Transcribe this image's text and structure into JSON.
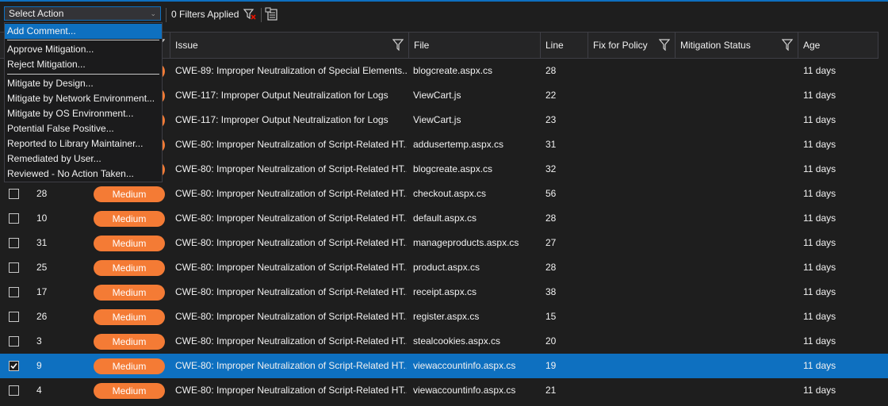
{
  "toolbar": {
    "select_action": "Select Action",
    "filters_applied": "0 Filters Applied",
    "clear_filter_icon": "filter-clear-icon",
    "export_icon": "export-icon"
  },
  "action_menu": {
    "items": [
      "Add Comment...",
      "Approve Mitigation...",
      "Reject Mitigation...",
      "Mitigate by Design...",
      "Mitigate by Network Environment...",
      "Mitigate by OS Environment...",
      "Potential False Positive...",
      "Reported to Library Maintainer...",
      "Remediated by User...",
      "Reviewed - No Action Taken..."
    ],
    "highlighted_index": 0
  },
  "columns": {
    "issue": "Issue",
    "file": "File",
    "line": "Line",
    "fix_for_policy": "Fix for Policy",
    "mitigation_status": "Mitigation Status",
    "age": "Age"
  },
  "colors": {
    "accent": "#0e70c0",
    "medium": "#f47b35",
    "high": "#e51400"
  },
  "rows": [
    {
      "id": "",
      "severity": "",
      "issue": "CWE-89: Improper Neutralization of Special Elements...",
      "file": "blogcreate.aspx.cs",
      "line": "28",
      "age": "11 days",
      "checked": false
    },
    {
      "id": "",
      "severity": "",
      "issue": "CWE-117: Improper Output Neutralization for Logs",
      "file": "ViewCart.js",
      "line": "22",
      "age": "11 days",
      "checked": false
    },
    {
      "id": "",
      "severity": "",
      "issue": "CWE-117: Improper Output Neutralization for Logs",
      "file": "ViewCart.js",
      "line": "23",
      "age": "11 days",
      "checked": false
    },
    {
      "id": "",
      "severity": "",
      "issue": "CWE-80: Improper Neutralization of Script-Related HT...",
      "file": "addusertemp.aspx.cs",
      "line": "31",
      "age": "11 days",
      "checked": false
    },
    {
      "id": "",
      "severity": "",
      "issue": "CWE-80: Improper Neutralization of Script-Related HT...",
      "file": "blogcreate.aspx.cs",
      "line": "32",
      "age": "11 days",
      "checked": false
    },
    {
      "id": "28",
      "severity": "Medium",
      "issue": "CWE-80: Improper Neutralization of Script-Related HT...",
      "file": "checkout.aspx.cs",
      "line": "56",
      "age": "11 days",
      "checked": false
    },
    {
      "id": "10",
      "severity": "Medium",
      "issue": "CWE-80: Improper Neutralization of Script-Related HT...",
      "file": "default.aspx.cs",
      "line": "28",
      "age": "11 days",
      "checked": false
    },
    {
      "id": "31",
      "severity": "Medium",
      "issue": "CWE-80: Improper Neutralization of Script-Related HT...",
      "file": "manageproducts.aspx.cs",
      "line": "27",
      "age": "11 days",
      "checked": false
    },
    {
      "id": "25",
      "severity": "Medium",
      "issue": "CWE-80: Improper Neutralization of Script-Related HT...",
      "file": "product.aspx.cs",
      "line": "28",
      "age": "11 days",
      "checked": false
    },
    {
      "id": "17",
      "severity": "Medium",
      "issue": "CWE-80: Improper Neutralization of Script-Related HT...",
      "file": "receipt.aspx.cs",
      "line": "38",
      "age": "11 days",
      "checked": false
    },
    {
      "id": "26",
      "severity": "Medium",
      "issue": "CWE-80: Improper Neutralization of Script-Related HT...",
      "file": "register.aspx.cs",
      "line": "15",
      "age": "11 days",
      "checked": false
    },
    {
      "id": "3",
      "severity": "Medium",
      "issue": "CWE-80: Improper Neutralization of Script-Related HT...",
      "file": "stealcookies.aspx.cs",
      "line": "20",
      "age": "11 days",
      "checked": false
    },
    {
      "id": "9",
      "severity": "Medium",
      "issue": "CWE-80: Improper Neutralization of Script-Related HT...",
      "file": "viewaccountinfo.aspx.cs",
      "line": "19",
      "age": "11 days",
      "checked": true,
      "selected": true
    },
    {
      "id": "4",
      "severity": "Medium",
      "issue": "CWE-80: Improper Neutralization of Script-Related HT...",
      "file": "viewaccountinfo.aspx.cs",
      "line": "21",
      "age": "11 days",
      "checked": false
    }
  ]
}
